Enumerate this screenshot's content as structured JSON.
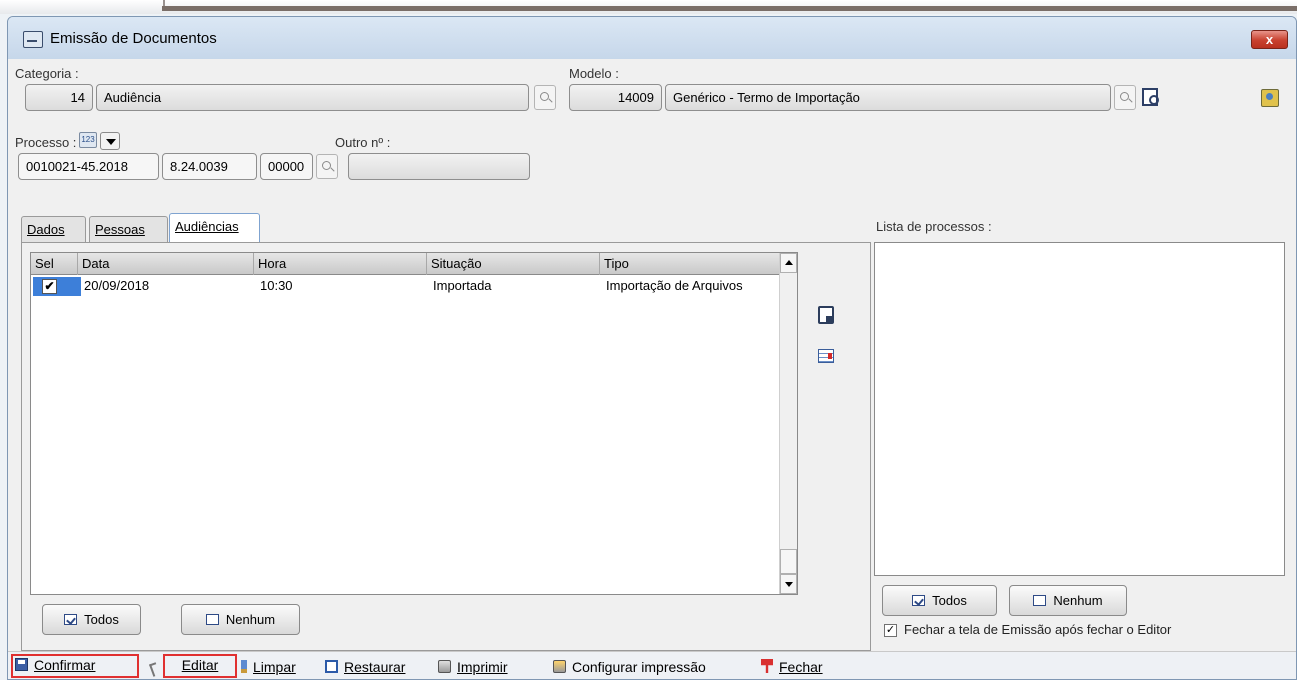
{
  "window": {
    "title": "Emissão de Documentos",
    "close_label": "x"
  },
  "categoria": {
    "label": "Categoria :",
    "code": "14",
    "name": "Audiência"
  },
  "modelo": {
    "label": "Modelo :",
    "code": "14009",
    "name": "Genérico -  Termo de Importação"
  },
  "processo": {
    "label": "Processo :",
    "part1": "0010021-45.2018",
    "part2": "8.24.0039",
    "part3": "00000",
    "outro_label": "Outro nº :",
    "outro_value": ""
  },
  "tabs": [
    {
      "label": "Dados"
    },
    {
      "label": "Pessoas"
    },
    {
      "label": "Audiências"
    }
  ],
  "grid": {
    "columns": [
      "Sel",
      "Data",
      "Hora",
      "Situação",
      "Tipo"
    ],
    "rows": [
      {
        "sel": "✔",
        "data": "20/09/2018",
        "hora": "10:30",
        "situacao": "Importada",
        "tipo": "Importação de Arquivos"
      }
    ]
  },
  "left_buttons": {
    "todos": "Todos",
    "nenhum": "Nenhum"
  },
  "lista": {
    "label": "Lista de processos :"
  },
  "right_buttons": {
    "todos": "Todos",
    "nenhum": "Nenhum"
  },
  "fechar_option": {
    "checked": "✓",
    "label": "Fechar a tela de Emissão após fechar o Editor"
  },
  "toolbar": {
    "confirmar": "Confirmar",
    "editar": "Editar",
    "limpar": "Limpar",
    "restaurar": "Restaurar",
    "imprimir": "Imprimir",
    "configurar": "Configurar impressão",
    "fechar": "Fechar"
  },
  "colors": {
    "highlight_border": "#e03030",
    "selection_blue": "#3d7fd9"
  }
}
